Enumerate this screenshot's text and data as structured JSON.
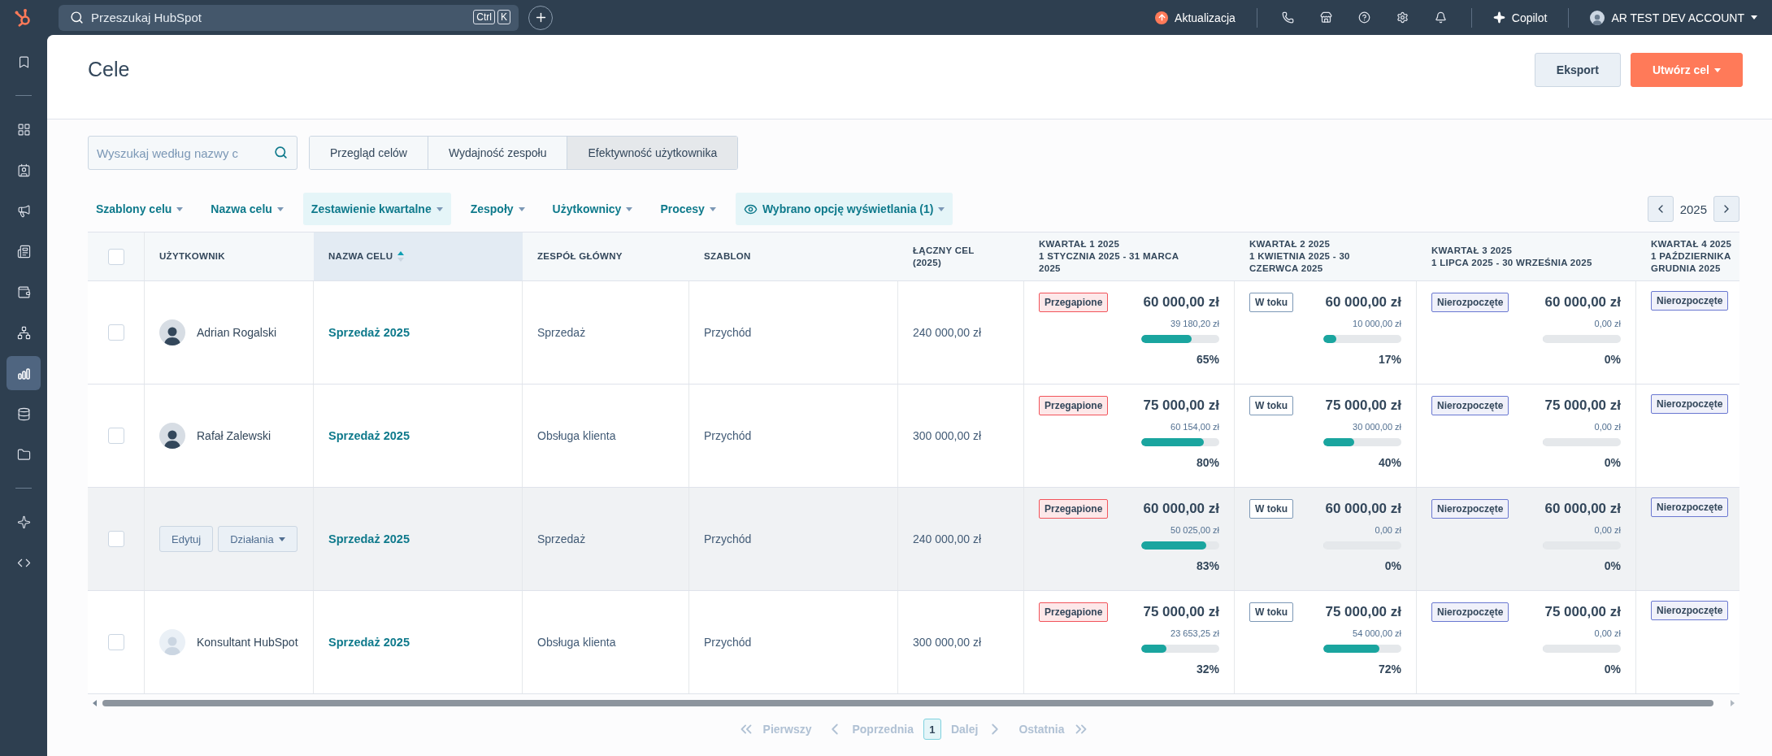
{
  "topbar": {
    "search": {
      "placeholder": "Przeszukaj HubSpot",
      "keys": [
        "Ctrl",
        "K"
      ]
    },
    "update": "Aktualizacja",
    "copilot": "Copilot",
    "account": "AR TEST DEV ACCOUNT"
  },
  "sidebar": {
    "items": [
      {
        "kind": "item",
        "selected": false
      },
      {
        "kind": "divider"
      },
      {
        "kind": "item",
        "selected": false
      },
      {
        "kind": "item",
        "selected": false
      },
      {
        "kind": "item",
        "selected": false
      },
      {
        "kind": "item",
        "selected": false
      },
      {
        "kind": "item",
        "selected": false
      },
      {
        "kind": "item",
        "selected": false
      },
      {
        "kind": "item",
        "selected": true
      },
      {
        "kind": "item",
        "selected": false
      },
      {
        "kind": "item",
        "selected": false
      },
      {
        "kind": "divider"
      },
      {
        "kind": "item",
        "selected": false
      },
      {
        "kind": "item",
        "selected": false
      }
    ]
  },
  "page": {
    "title": "Cele",
    "buttons": [
      {
        "label": "Eksport",
        "kind": "secondary"
      },
      {
        "label": "Utwórz cel",
        "kind": "primary"
      }
    ]
  },
  "search": {
    "placeholder": "Wyszukaj według nazwy c"
  },
  "tabs": [
    {
      "label": "Przegląd celów",
      "selected": false
    },
    {
      "label": "Wydajność zespołu",
      "selected": false
    },
    {
      "label": "Efektywność użytkownika",
      "selected": true
    }
  ],
  "filters": [
    {
      "label": "Szablony celu",
      "selected": false
    },
    {
      "label": "Nazwa celu",
      "selected": false
    },
    {
      "label": "Zestawienie kwartalne",
      "selected": true
    },
    {
      "label": "Zespoły",
      "selected": false
    },
    {
      "label": "Użytkownicy",
      "selected": false
    },
    {
      "label": "Procesy",
      "selected": false
    },
    {
      "label": "Wybrano opcję wyświetlania (1)",
      "selected": true,
      "kind": "view"
    }
  ],
  "year_nav": {
    "year": "2025"
  },
  "table": {
    "header_checkbox": {
      "checked": false
    },
    "columns": [
      {
        "lines": [
          "UŻYTKOWNIK"
        ],
        "sorted": false
      },
      {
        "lines": [
          "NAZWA CELU"
        ],
        "sorted": true
      },
      {
        "lines": [
          "ZESPÓŁ GŁÓWNY"
        ],
        "sorted": false
      },
      {
        "lines": [
          "SZABLON"
        ],
        "sorted": false
      },
      {
        "lines": [
          "ŁĄCZNY CEL",
          "(2025)"
        ],
        "sorted": false
      },
      {
        "lines": [
          "KWARTAŁ 1 2025",
          "1 STYCZNIA 2025 - 31 MARCA",
          "2025"
        ],
        "sorted": false
      },
      {
        "lines": [
          "KWARTAŁ 2 2025",
          "1 KWIETNIA 2025 - 30",
          "CZERWCA 2025"
        ],
        "sorted": false
      },
      {
        "lines": [
          "KWARTAŁ 3 2025",
          "1 LIPCA 2025 - 30 WRZEŚNIA 2025"
        ],
        "sorted": false
      },
      {
        "lines": [
          "KWARTAŁ 4 2025",
          "1 PAŹDZIERNIKA",
          "GRUDNIA 2025"
        ],
        "sorted": false
      }
    ],
    "rows": [
      {
        "checked": false,
        "hovered": false,
        "user": {
          "name": "Adrian Rogalski",
          "kind": "photo"
        },
        "goal": "Sprzedaż 2025",
        "team": "Sprzedaż",
        "template": "Przychód",
        "total": "240 000,00 zł",
        "quarters": [
          {
            "status": {
              "label": "Przegapione",
              "kind": "missed"
            },
            "target": "60 000,00 zł",
            "achieved": "39 180,20 zł",
            "level": 0.65,
            "percent": "65%"
          },
          {
            "status": {
              "label": "W toku",
              "kind": "in_progress"
            },
            "target": "60 000,00 zł",
            "achieved": "10 000,00 zł",
            "level": 0.17,
            "percent": "17%"
          },
          {
            "status": {
              "label": "Nierozpoczęte",
              "kind": "not_started"
            },
            "target": "60 000,00 zł",
            "achieved": "0,00 zł",
            "level": 0,
            "percent": "0%"
          },
          {
            "status": {
              "label": "Nierozpoczęte",
              "kind": "not_started"
            }
          }
        ]
      },
      {
        "checked": false,
        "hovered": false,
        "user": {
          "name": "Rafał Zalewski",
          "kind": "photo"
        },
        "goal": "Sprzedaż 2025",
        "team": "Obsługa klienta",
        "template": "Przychód",
        "total": "300 000,00 zł",
        "quarters": [
          {
            "status": {
              "label": "Przegapione",
              "kind": "missed"
            },
            "target": "75 000,00 zł",
            "achieved": "60 154,00 zł",
            "level": 0.8,
            "percent": "80%"
          },
          {
            "status": {
              "label": "W toku",
              "kind": "in_progress"
            },
            "target": "75 000,00 zł",
            "achieved": "30 000,00 zł",
            "level": 0.4,
            "percent": "40%"
          },
          {
            "status": {
              "label": "Nierozpoczęte",
              "kind": "not_started"
            },
            "target": "75 000,00 zł",
            "achieved": "0,00 zł",
            "level": 0,
            "percent": "0%"
          },
          {
            "status": {
              "label": "Nierozpoczęte",
              "kind": "not_started"
            }
          }
        ]
      },
      {
        "checked": false,
        "hovered": true,
        "actions": [
          "Edytuj",
          "Działania"
        ],
        "goal": "Sprzedaż 2025",
        "team": "Sprzedaż",
        "template": "Przychód",
        "total": "240 000,00 zł",
        "quarters": [
          {
            "status": {
              "label": "Przegapione",
              "kind": "missed"
            },
            "target": "60 000,00 zł",
            "achieved": "50 025,00 zł",
            "level": 0.83,
            "percent": "83%"
          },
          {
            "status": {
              "label": "W toku",
              "kind": "in_progress"
            },
            "target": "60 000,00 zł",
            "achieved": "0,00 zł",
            "level": 0,
            "percent": "0%"
          },
          {
            "status": {
              "label": "Nierozpoczęte",
              "kind": "not_started"
            },
            "target": "60 000,00 zł",
            "achieved": "0,00 zł",
            "level": 0,
            "percent": "0%"
          },
          {
            "status": {
              "label": "Nierozpoczęte",
              "kind": "not_started"
            }
          }
        ]
      },
      {
        "checked": false,
        "hovered": false,
        "user": {
          "name": "Konsultant HubSpot",
          "kind": "placeholder"
        },
        "goal": "Sprzedaż 2025",
        "team": "Obsługa klienta",
        "template": "Przychód",
        "total": "300 000,00 zł",
        "quarters": [
          {
            "status": {
              "label": "Przegapione",
              "kind": "missed"
            },
            "target": "75 000,00 zł",
            "achieved": "23 653,25 zł",
            "level": 0.32,
            "percent": "32%"
          },
          {
            "status": {
              "label": "W toku",
              "kind": "in_progress"
            },
            "target": "75 000,00 zł",
            "achieved": "54 000,00 zł",
            "level": 0.72,
            "percent": "72%"
          },
          {
            "status": {
              "label": "Nierozpoczęte",
              "kind": "not_started"
            },
            "target": "75 000,00 zł",
            "achieved": "0,00 zł",
            "level": 0,
            "percent": "0%"
          },
          {
            "status": {
              "label": "Nierozpoczęte",
              "kind": "not_started"
            }
          }
        ]
      }
    ]
  },
  "pagination": {
    "first": {
      "label": "Pierwszy",
      "disabled": true
    },
    "prev": {
      "label": "Poprzednia",
      "disabled": true
    },
    "pages": [
      {
        "label": "1",
        "selected": true
      }
    ],
    "next": {
      "label": "Dalej",
      "disabled": true
    },
    "last": {
      "label": "Ostatnia",
      "disabled": true
    }
  }
}
